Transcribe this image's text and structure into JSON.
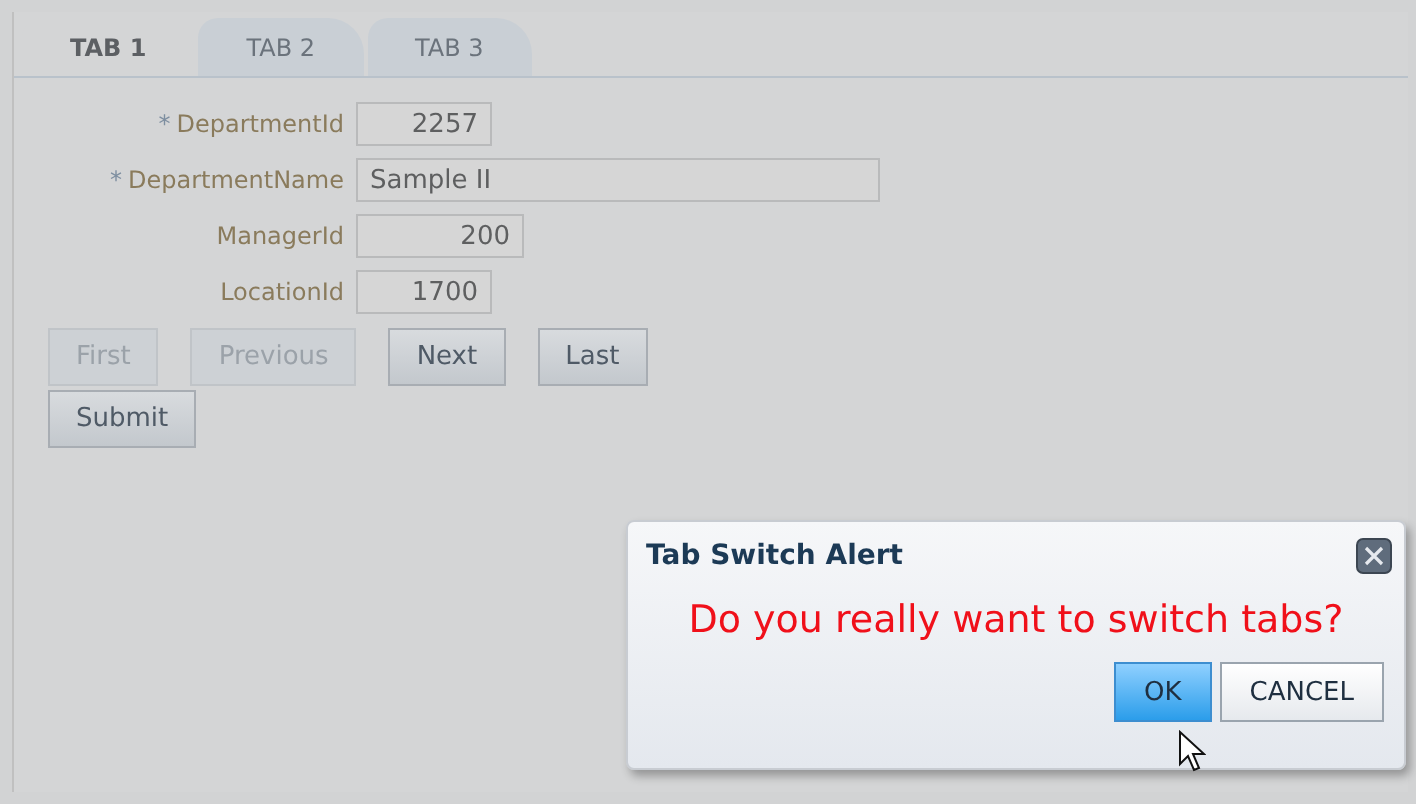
{
  "tabs": [
    {
      "label": "TAB 1",
      "selected": true
    },
    {
      "label": "TAB 2",
      "selected": false
    },
    {
      "label": "TAB 3",
      "selected": false
    }
  ],
  "form": {
    "fields": [
      {
        "label": "DepartmentId",
        "required": true,
        "value": "2257",
        "kind": "number"
      },
      {
        "label": "DepartmentName",
        "required": true,
        "value": "Sample II",
        "kind": "text"
      },
      {
        "label": "ManagerId",
        "required": false,
        "value": "200",
        "kind": "number"
      },
      {
        "label": "LocationId",
        "required": false,
        "value": "1700",
        "kind": "number"
      }
    ],
    "required_mark": "*",
    "nav_buttons": [
      {
        "label": "First",
        "disabled": true
      },
      {
        "label": "Previous",
        "disabled": true
      },
      {
        "label": "Next",
        "disabled": false
      },
      {
        "label": "Last",
        "disabled": false
      }
    ],
    "submit": "Submit"
  },
  "dialog": {
    "title": "Tab Switch Alert",
    "message": "Do you really want to switch tabs?",
    "buttons": [
      {
        "label": "OK",
        "selected": true
      },
      {
        "label": "CANCEL",
        "selected": false
      }
    ]
  }
}
